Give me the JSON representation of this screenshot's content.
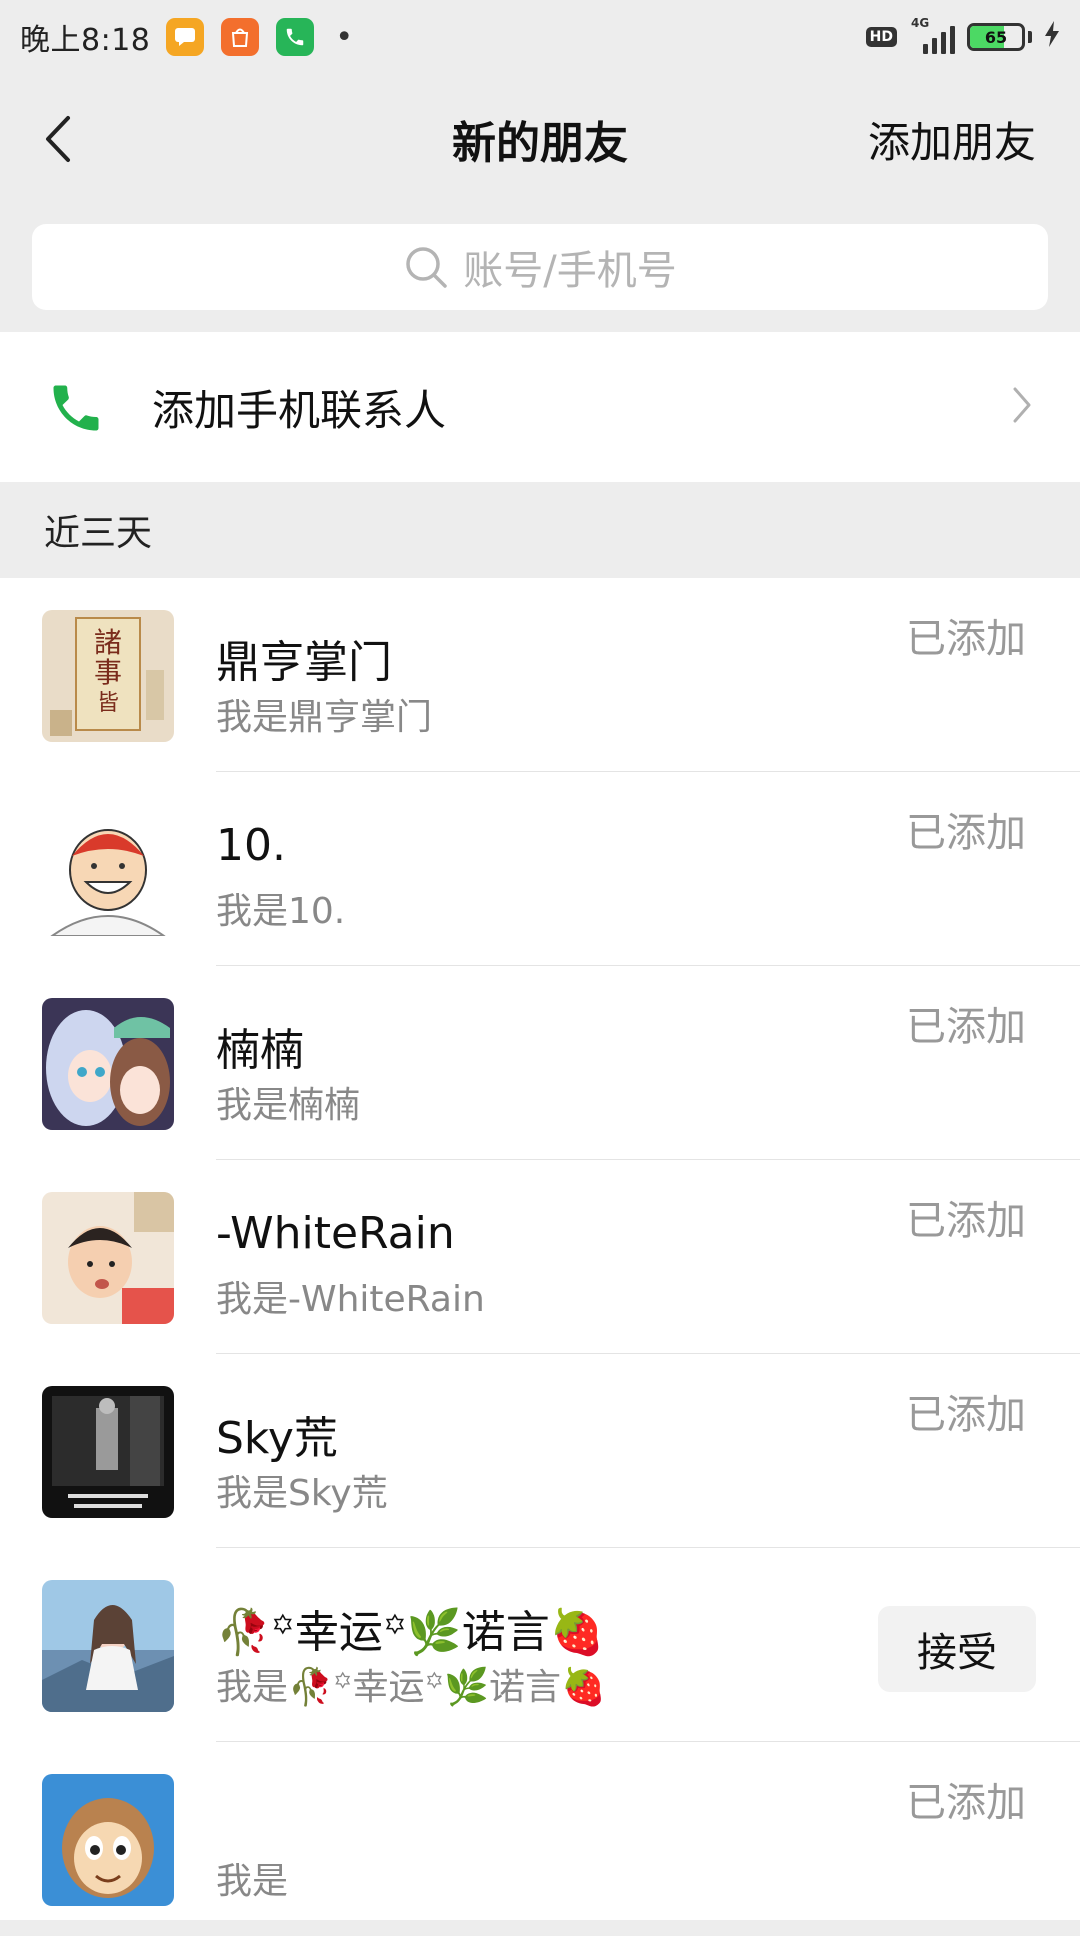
{
  "status_bar": {
    "time": "晚上8:18",
    "app_icons": [
      "message-app-icon",
      "mi-store-app-icon",
      "phone-app-icon"
    ],
    "hd_label": "HD",
    "network_label": "4G",
    "battery_level": "65",
    "battery_fraction": 0.65
  },
  "nav": {
    "title": "新的朋友",
    "action_label": "添加朋友"
  },
  "search": {
    "placeholder": "账号/手机号"
  },
  "phone_contacts": {
    "label": "添加手机联系人"
  },
  "section": {
    "title": "近三天"
  },
  "requests": [
    {
      "name": "鼎亨掌门",
      "message": "我是鼎亨掌门",
      "status": "已添加",
      "avatar": "calligraphy-scroll-avatar"
    },
    {
      "name": "10.",
      "message": "我是10.",
      "status": "已添加",
      "avatar": "cartoon-boy-avatar"
    },
    {
      "name": "楠楠",
      "message": "我是楠楠",
      "status": "已添加",
      "avatar": "anime-girls-avatar"
    },
    {
      "name": "-WhiteRain",
      "message": "我是-WhiteRain",
      "status": "已添加",
      "avatar": "child-photo-avatar"
    },
    {
      "name": "Sky荒",
      "message": "我是Sky荒",
      "status": "已添加",
      "avatar": "dark-street-avatar"
    },
    {
      "name": "🥀꙳幸运꙳🌿诺言🍓",
      "message": "我是🥀꙳幸运꙳🌿诺言🍓",
      "status": "",
      "action": "接受",
      "avatar": "painted-girl-avatar"
    },
    {
      "name": "",
      "message": "我是",
      "status": "已添加",
      "avatar": "cartoon-monkey-avatar"
    }
  ],
  "colors": {
    "background": "#ededed",
    "phone_green": "#22b14c",
    "battery_green": "#4cd964",
    "muted_text": "#888888"
  }
}
